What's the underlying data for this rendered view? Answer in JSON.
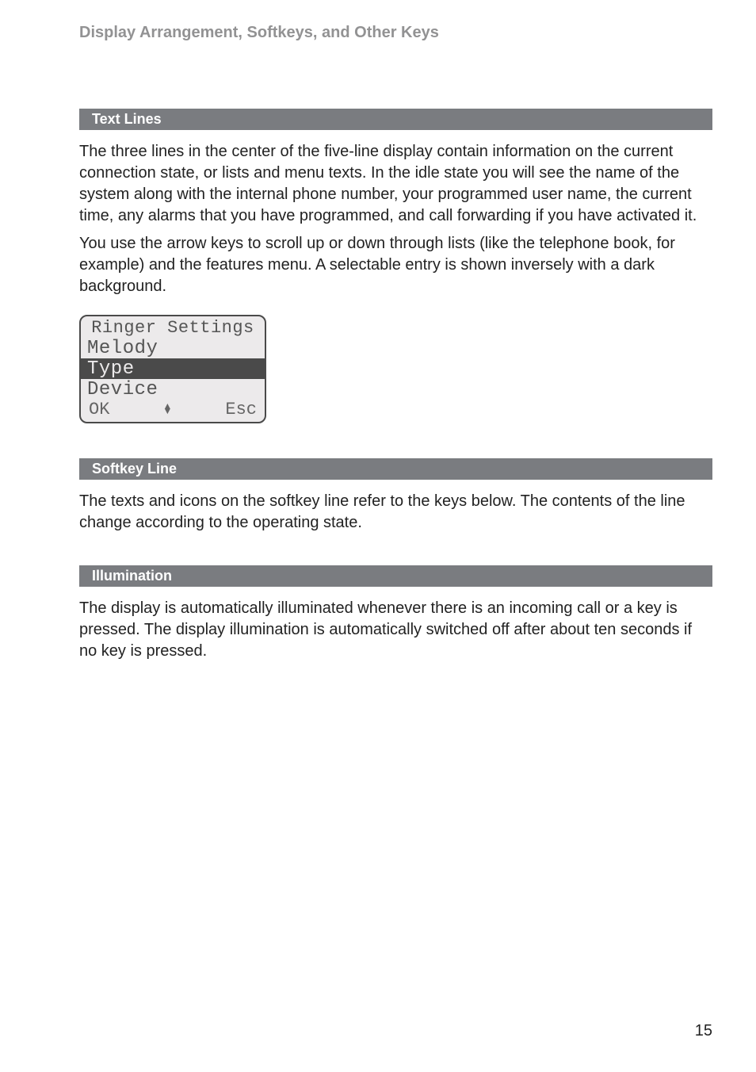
{
  "header": {
    "running_head": "Display Arrangement, Softkeys, and Other Keys"
  },
  "sections": {
    "text_lines": {
      "heading": "Text Lines",
      "para1": "The three lines in the center of the five-line display contain information on the current connection state, or lists and menu texts. In the idle state you will see the name of the system along with the internal phone number, your programmed user name, the current time, any alarms that you have programmed, and call forwarding if you have activated it.",
      "para2": "You use the arrow keys to scroll up or down through lists (like the telephone book, for example) and the features menu. A selectable entry is shown inversely with a dark background."
    },
    "softkey_line": {
      "heading": "Softkey Line",
      "para1": "The texts and icons on the softkey line refer to the keys below. The contents of the line change according to the operating state."
    },
    "illumination": {
      "heading": "Illumination",
      "para1": "The display is automatically illuminated whenever there is an incoming call or a key is pressed. The display illumination is automatically switched off after about ten seconds if no key is pressed."
    }
  },
  "lcd": {
    "title": "Ringer Settings",
    "rows": [
      "Melody",
      "Type",
      "Device"
    ],
    "softkeys": {
      "left": "OK",
      "right": "Esc"
    }
  },
  "page_number": "15"
}
